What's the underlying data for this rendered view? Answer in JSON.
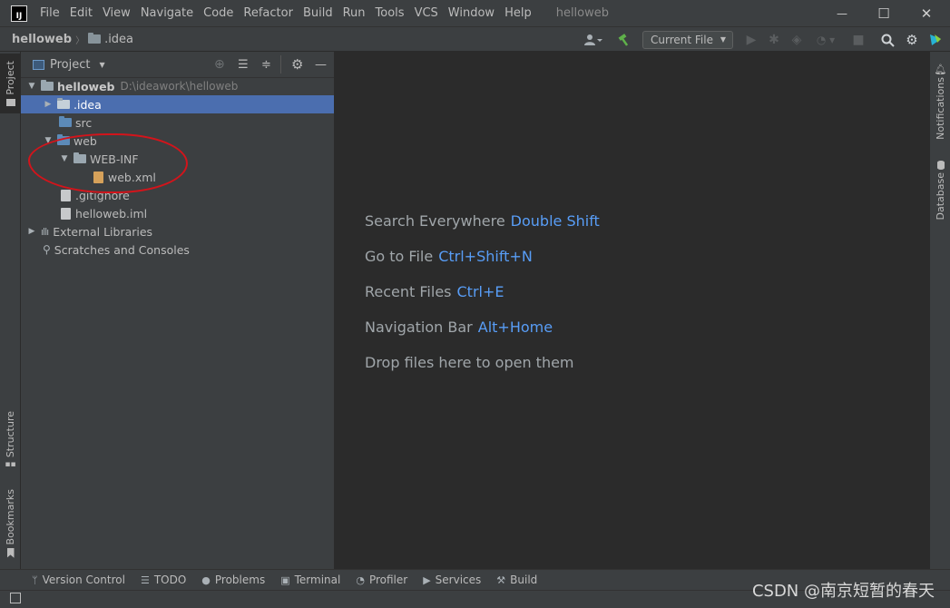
{
  "titlebar": {
    "logo_text": "IJ",
    "menu": [
      "File",
      "Edit",
      "View",
      "Navigate",
      "Code",
      "Refactor",
      "Build",
      "Run",
      "Tools",
      "VCS",
      "Window",
      "Help"
    ],
    "window_title": "helloweb",
    "controls": {
      "minimize": "—",
      "maximize": "☐",
      "close": "✕"
    }
  },
  "navbar": {
    "crumb_project": "helloweb",
    "crumb_folder": ".idea",
    "run_config": "Current File"
  },
  "left_tabs": {
    "project": "Project",
    "structure": "Structure",
    "bookmarks": "Bookmarks"
  },
  "right_tabs": {
    "notifications": "Notifications",
    "database": "Database"
  },
  "project_panel": {
    "title": "Project",
    "tree": [
      {
        "label": "helloweb",
        "hint": "D:\\ideawork\\helloweb"
      },
      {
        "label": ".idea"
      },
      {
        "label": "src"
      },
      {
        "label": "web"
      },
      {
        "label": "WEB-INF"
      },
      {
        "label": "web.xml"
      },
      {
        "label": ".gitignore"
      },
      {
        "label": "helloweb.iml"
      },
      {
        "label": "External Libraries"
      },
      {
        "label": "Scratches and Consoles"
      }
    ]
  },
  "editor": {
    "hints": [
      {
        "label": "Search Everywhere",
        "key": "Double Shift"
      },
      {
        "label": "Go to File",
        "key": "Ctrl+Shift+N"
      },
      {
        "label": "Recent Files",
        "key": "Ctrl+E"
      },
      {
        "label": "Navigation Bar",
        "key": "Alt+Home"
      },
      {
        "label": "Drop files here to open them",
        "key": ""
      }
    ]
  },
  "statusbar": {
    "items": [
      "Version Control",
      "TODO",
      "Problems",
      "Terminal",
      "Profiler",
      "Services",
      "Build"
    ]
  },
  "watermark": "CSDN @南京短暂的春天",
  "colors": {
    "selection": "#4b6eaf",
    "key": "#589df6",
    "annotation": "#d3141b"
  }
}
